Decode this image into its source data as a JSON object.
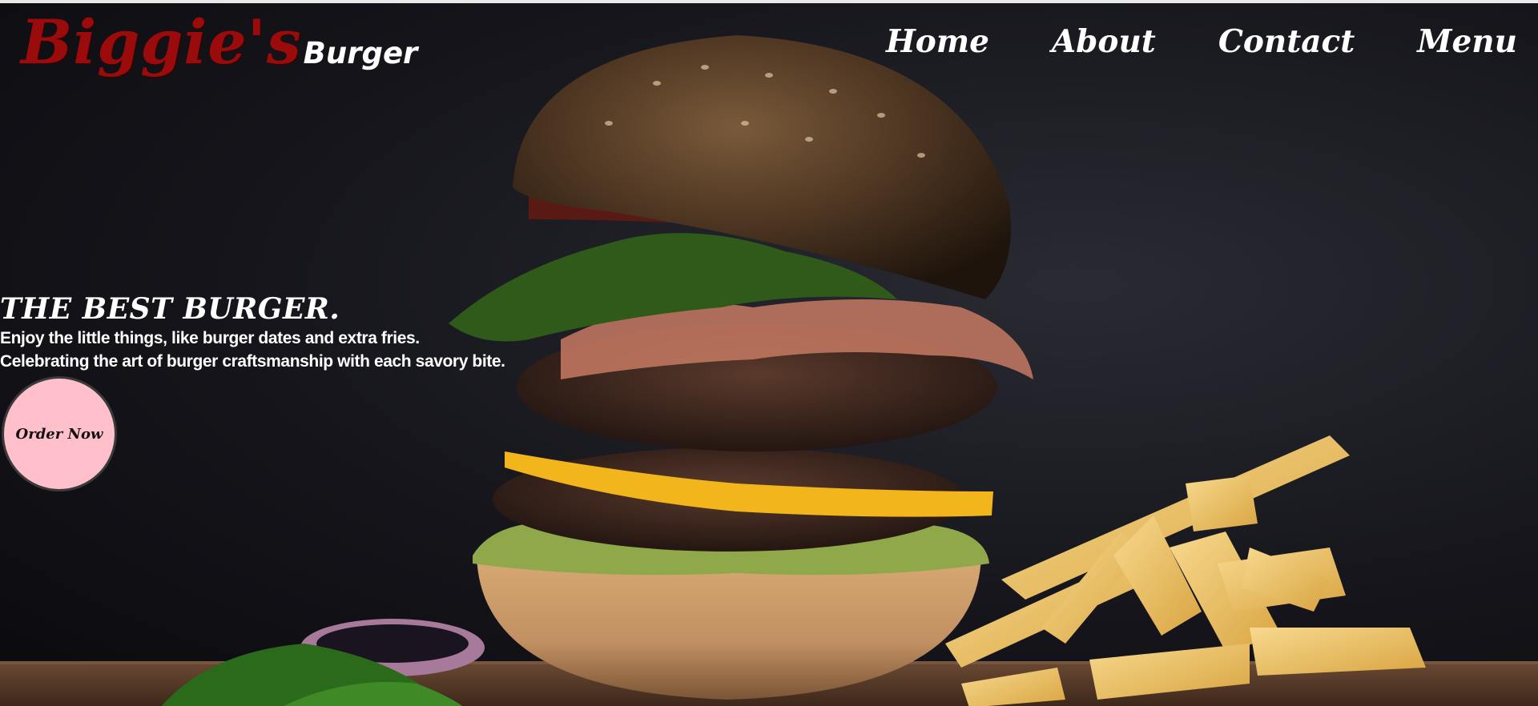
{
  "brand": {
    "name": "Biggie's",
    "suffix": "Burger"
  },
  "nav": {
    "home": "Home",
    "about": "About",
    "contact": "Contact",
    "menu": "Menu"
  },
  "hero": {
    "title": "THE BEST BURGER.",
    "line1": "Enjoy the little things, like burger dates and extra fries.",
    "line2": "Celebrating the art of burger craftsmanship with each savory bite.",
    "cta": "Order Now"
  },
  "colors": {
    "brand_red": "#9a0b0b",
    "cta_pink": "#ffc0cb",
    "text": "#ffffff",
    "background": "#15151b"
  },
  "icons": [
    "burger-hero-image",
    "fries-image",
    "onion-image",
    "basil-leaf-image"
  ]
}
